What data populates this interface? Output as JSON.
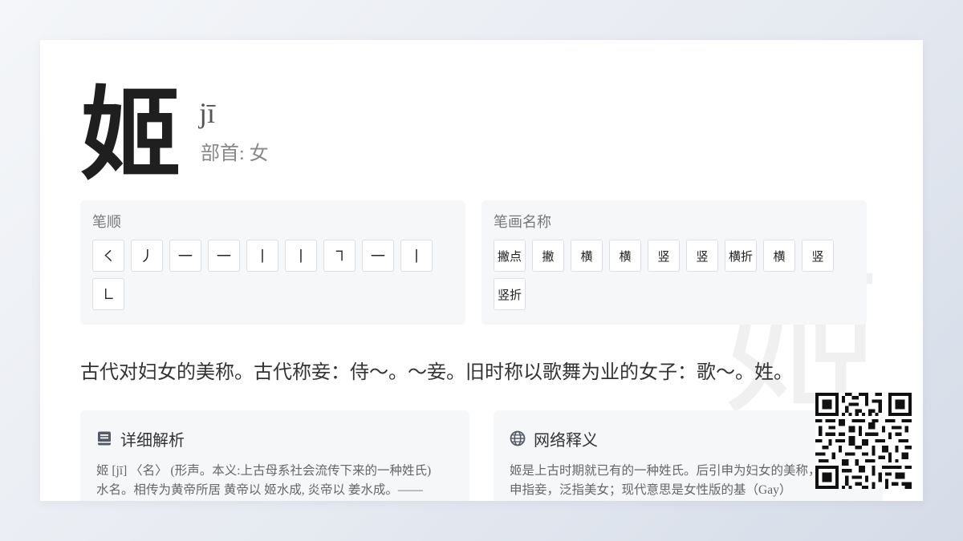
{
  "character": "姬",
  "pinyin": "jī",
  "radical_label": "部首: 女",
  "stroke_order": {
    "title": "笔顺",
    "strokes": [
      "㇛",
      "丿",
      "一",
      "一",
      "丨",
      "丨",
      "㇕",
      "一",
      "丨",
      "㇗"
    ]
  },
  "stroke_names": {
    "title": "笔画名称",
    "names": [
      "撇点",
      "撇",
      "横",
      "横",
      "竖",
      "竖",
      "横折",
      "横",
      "竖",
      "竖折"
    ]
  },
  "definition": "古代对妇女的美称。古代称妾：侍～。～妾。旧时称以歌舞为业的女子：歌～。姓。",
  "detail": {
    "title": "详细解析",
    "icon": "book-icon",
    "lines": [
      "姬 [jī] 〈名〉 (形声。本义:上古母系社会流传下来的一种姓氏)",
      "水名。相传为黄帝所居 黄帝以 姬水成, 炎帝以 姜水成。——"
    ]
  },
  "web": {
    "title": "网络释义",
    "icon": "globe-icon",
    "lines": [
      "姬是上古时期就已有的一种姓氏。后引申为妇女的美称，再引",
      "申指妾，泛指美女；现代意思是女性版的基（Gay）"
    ]
  },
  "colors": {
    "icon": "#555b66",
    "panel_bg": "#f6f7f9",
    "card_bg": "#ffffff"
  }
}
